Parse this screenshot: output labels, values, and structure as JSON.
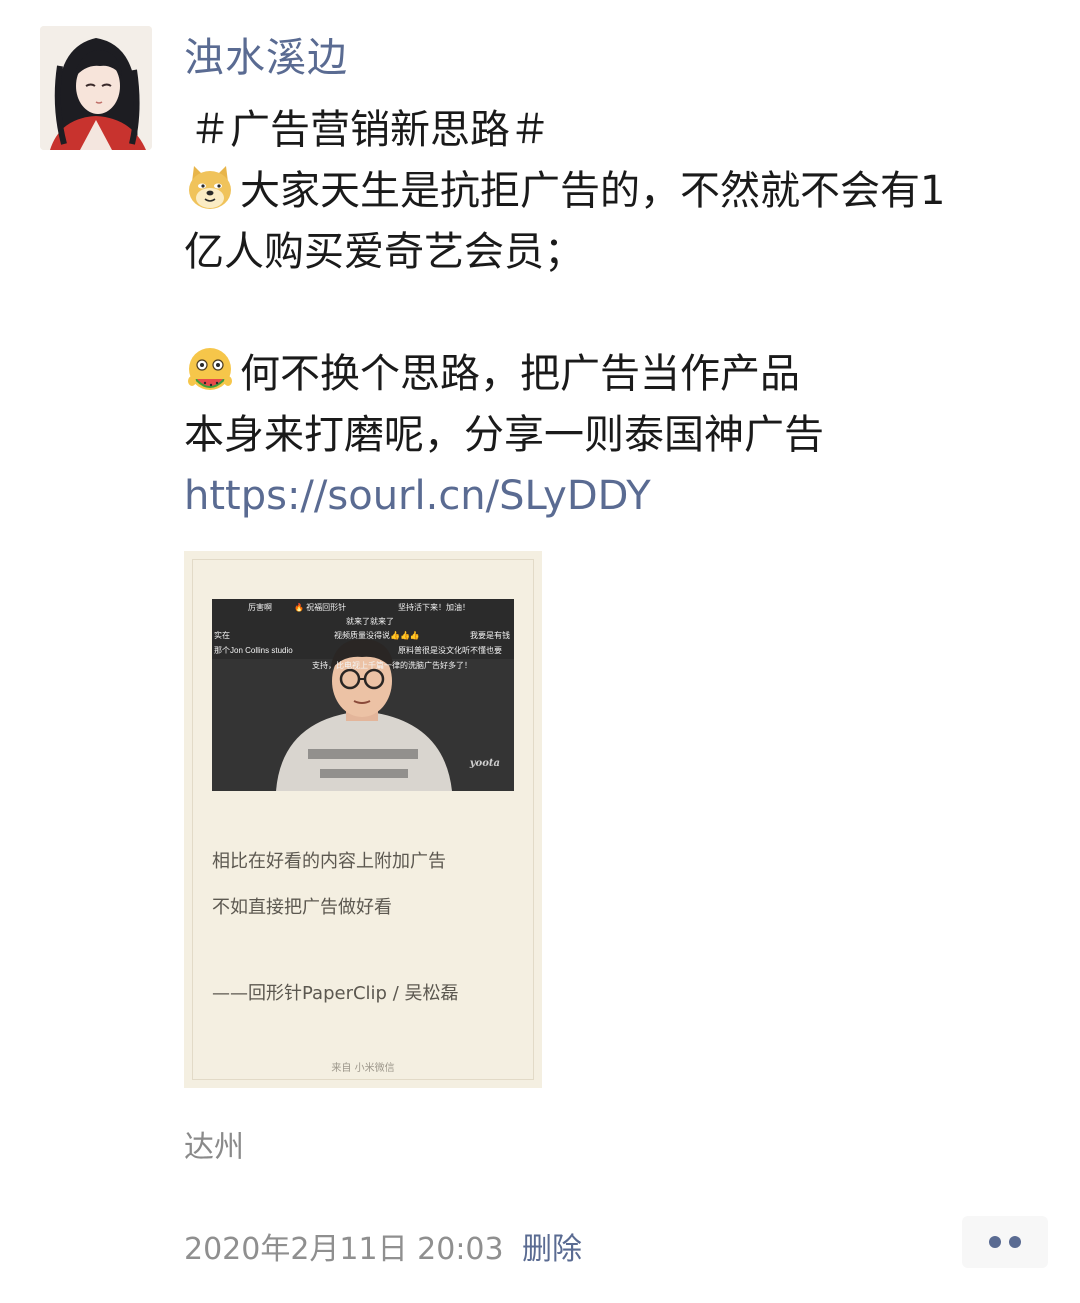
{
  "post": {
    "username": "浊水溪边",
    "hashtag": "＃广告营销新思路＃",
    "paragraph1": {
      "emoji": "doge-emoji",
      "line1": "大家天生是抗拒广告的，不然就不会有1",
      "line2": "亿人购买爱奇艺会员；"
    },
    "paragraph2": {
      "emoji": "eating-watermelon-emoji",
      "line1": "何不换个思路，把广告当作产品",
      "line2": "本身来打磨呢，分享一则泰国神广告"
    },
    "link": "https://sourl.cn/SLyDDY",
    "location": "达州",
    "timestamp": "2020年2月11日 20:03",
    "delete_label": "删除"
  },
  "image_card": {
    "danmaku": [
      "厉害啊",
      "🔥 祝福回形针",
      "坚持活下来！加油！",
      "就来了就来了",
      "实在",
      "视频质量没得说👍👍👍",
      "我要是有钱",
      "那个Jon Collins studio",
      "原料普很是没文化听不懂也要",
      "支持，比电视上千篇一律的洗脑广告好多了！"
    ],
    "video_watermark": "yoota",
    "quote_line1": "相比在好看的内容上附加广告",
    "quote_line2": "不如直接把广告做好看",
    "attribution": "——回形针PaperClip / 吴松磊",
    "source": "来自 小米微信"
  }
}
